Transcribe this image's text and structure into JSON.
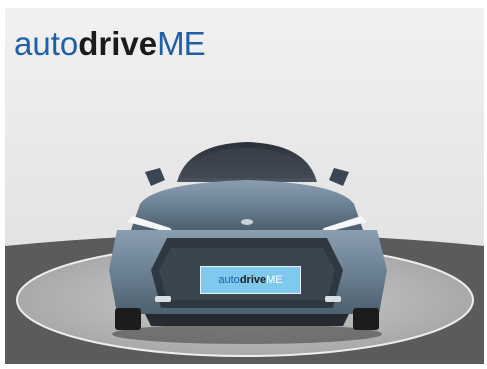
{
  "logo": {
    "part1": "auto",
    "part2": "drive",
    "part3": "ME"
  },
  "plate": {
    "part1": "auto",
    "part2": "drive",
    "part3": "ME"
  },
  "colors": {
    "logo_light": "#1f5fa8",
    "logo_dark": "#1b1b1b",
    "car_body": "#6f8497",
    "backdrop": "#ececec",
    "floor": "#5a5a5a",
    "turntable": "#bdbdbd",
    "plate": "#7fc9ee"
  }
}
